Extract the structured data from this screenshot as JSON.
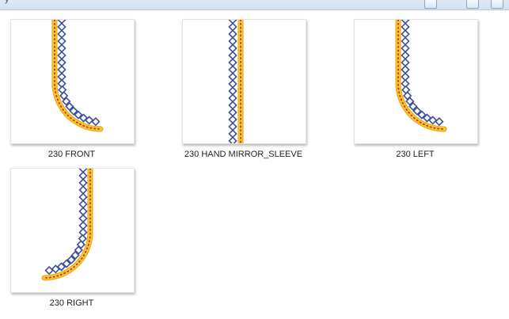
{
  "window": {
    "title_fragment": "y"
  },
  "files": [
    {
      "name": "230 FRONT",
      "shape": "curve-right"
    },
    {
      "name": "230 HAND MIRROR_SLEEVE",
      "shape": "straight"
    },
    {
      "name": "230 LEFT",
      "shape": "curve-right"
    },
    {
      "name": "230 RIGHT",
      "shape": "curve-left"
    }
  ],
  "colors": {
    "stitch_yellow": "#f5cc2a",
    "stitch_orange": "#e8a01c",
    "stitch_red_dots": "#d62828",
    "bead_blue": "#3b4f9a"
  }
}
